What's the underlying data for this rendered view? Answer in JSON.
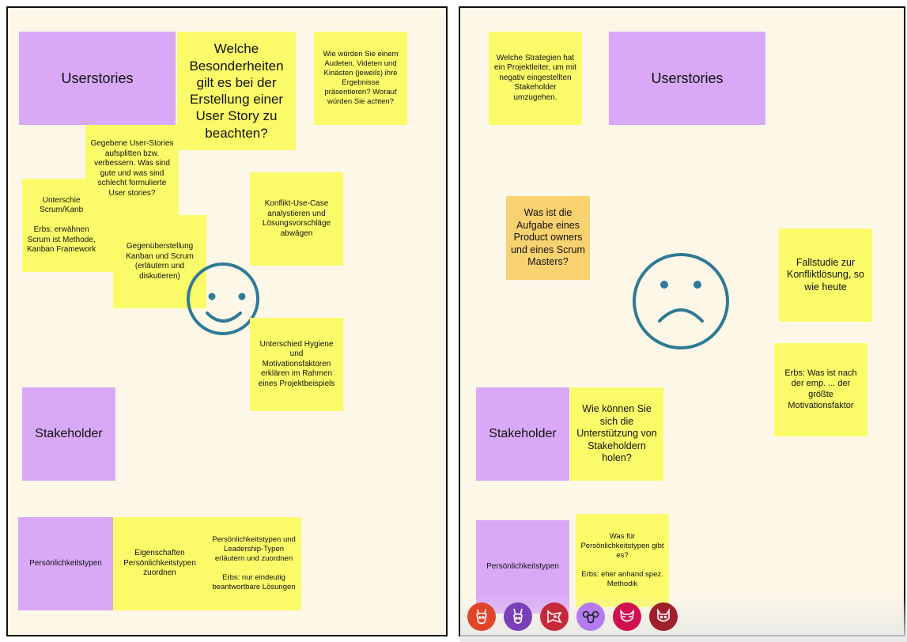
{
  "board_left": {
    "userstories_title": "Userstories",
    "q_besonderheiten": "Welche Besonderheiten gilt es bei der Erstellung einer User Story zu beachten?",
    "q_audeten": "Wie würden Sie einem Audeten, Videten und Kinästen (jeweils) ihre Ergebnisse präsentieren? Worauf würden Sie achten?",
    "note_userstories_split": "Gegebene User-Stories aufsplitten bzw. verbessern. Was sind gute und was sind schlecht formulierte User stories?",
    "note_scrum_kanban": "Unterschie\nScrum/Kanb\n\nErbs: erwähnen\nScrum ist Methode,\nKanban Framework",
    "note_gegenueberstellung": "Gegenüberstellung Kanban und Scrum (erläutern und diskutieren)",
    "note_konflikt": "Konflikt-Use-Case analystieren und Lösungsvorschläge abwägen",
    "note_hygiene": "Unterschied Hygiene und Motivationsfaktoren erklären im Rahmen eines Projektbeispiels",
    "stakeholder_title": "Stakeholder",
    "persoenlichkeit_title": "Persönlichkeitstypen",
    "note_eigenschaften": "Eigenschaften Persönlichkeitstypen zuordnen",
    "note_leadership": "Persönlichkeitstypen und Leadership-Typen erläutern und zuordnen\n\nErbs: nur eindeutig beantwortbare Lösungen",
    "face_mood": "happy"
  },
  "board_right": {
    "note_strategien": "Welche Strategien hat ein Projektleiter, um mit negativ eingestellten Stakeholder umzugehen.",
    "userstories_title": "Userstories",
    "note_product_owner": "Was ist die Aufgabe eines Product owners und eines Scrum Masters?",
    "note_fallstudie": "Fallstudie zur Konfliktlösung, so wie heute",
    "note_erbs_motivation": "Erbs: Was ist nach der emp. ... der größte Motivationsfaktor",
    "stakeholder_title": "Stakeholder",
    "note_unterstuetzung": "Wie können Sie sich die Unterstützung von Stakeholdern holen?",
    "persoenlichkeit_title": "Persönlichkeitstypen",
    "note_welche_typen": "Was für Persönlichkeitstypen gibt es?\n\nErbs: eher anhand spez. Methodik",
    "face_mood": "sad"
  },
  "avatars": [
    {
      "icon": "giraffe-icon",
      "color": "#e0452a"
    },
    {
      "icon": "kangaroo-icon",
      "color": "#7b3fb8"
    },
    {
      "icon": "fox-icon",
      "color": "#c62a3a"
    },
    {
      "icon": "ram-icon",
      "color": "#b57af0"
    },
    {
      "icon": "raccoon-icon",
      "color": "#d0104f"
    },
    {
      "icon": "wolf-icon",
      "color": "#a01f2d"
    }
  ],
  "colors": {
    "board_bg": "#fdf7e8",
    "sticky_yellow": "#fbfb6a",
    "sticky_purple": "#d9a9f7",
    "sticky_orange": "#f8d270",
    "face_stroke": "#2f7a96"
  }
}
